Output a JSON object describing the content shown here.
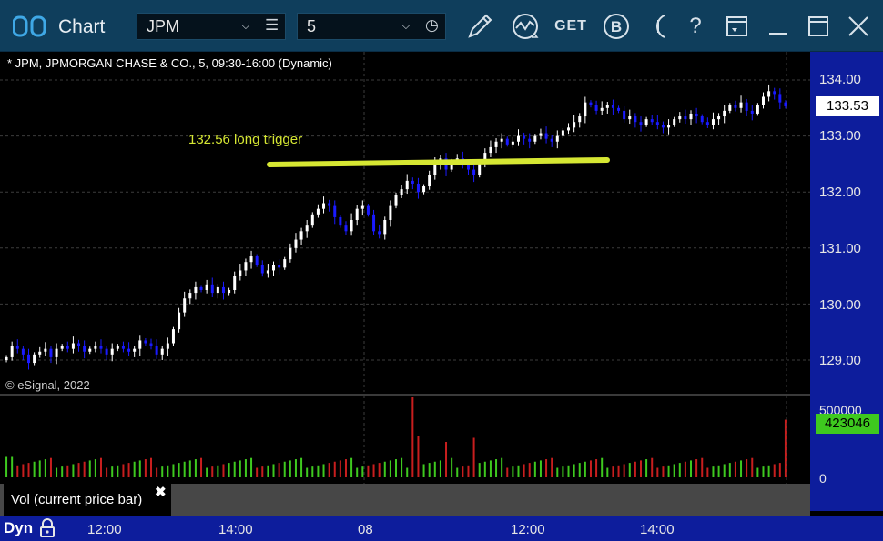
{
  "app": {
    "title": "Chart"
  },
  "toolbar": {
    "symbol": "JPM",
    "interval": "5",
    "get_label": "GET",
    "b_label": "B",
    "help_label": "?"
  },
  "chart": {
    "header": "* JPM, JPMORGAN CHASE & CO., 5, 09:30-16:00 (Dynamic)",
    "watermark": "© eSignal, 2022",
    "annotation": "132.56 long trigger",
    "last_price": "133.53",
    "last_volume": "423046",
    "price_labels": [
      "134.00",
      "133.00",
      "132.00",
      "131.00",
      "130.00",
      "129.00"
    ],
    "volume_labels": [
      "500000",
      "0"
    ],
    "time_labels": [
      "12:00",
      "14:00",
      "08",
      "12:00",
      "14:00"
    ],
    "volume_legend": "Vol (current price bar)",
    "mode_label": "Dyn",
    "colors": {
      "up": "#ffffff",
      "down": "#1a1aff",
      "vol_up": "#3ec91f",
      "vol_down": "#c81e1e",
      "trigger": "#d6e733",
      "axis_bg": "#0d1d9c"
    }
  },
  "chart_data": {
    "type": "candlestick",
    "title": "* JPM, JPMORGAN CHASE & CO., 5, 09:30-16:00 (Dynamic)",
    "ylim": [
      128.8,
      134.3
    ],
    "closes": [
      129.05,
      129.25,
      129.2,
      129.1,
      128.95,
      129.1,
      129.15,
      129.2,
      129.05,
      129.2,
      129.25,
      129.2,
      129.3,
      129.25,
      129.15,
      129.2,
      129.25,
      129.2,
      129.1,
      129.2,
      129.25,
      129.2,
      129.15,
      129.2,
      129.35,
      129.3,
      129.25,
      129.1,
      129.2,
      129.3,
      129.55,
      129.85,
      130.1,
      130.2,
      130.3,
      130.25,
      130.35,
      130.2,
      130.3,
      130.2,
      130.25,
      130.5,
      130.6,
      130.75,
      130.85,
      130.7,
      130.55,
      130.6,
      130.7,
      130.65,
      130.8,
      131.0,
      131.15,
      131.3,
      131.4,
      131.6,
      131.7,
      131.8,
      131.75,
      131.55,
      131.4,
      131.3,
      131.5,
      131.7,
      131.75,
      131.6,
      131.3,
      131.25,
      131.5,
      131.75,
      131.95,
      132.05,
      132.2,
      132.15,
      132.0,
      132.1,
      132.3,
      132.5,
      132.6,
      132.4,
      132.55,
      132.6,
      132.5,
      132.4,
      132.3,
      132.5,
      132.7,
      132.8,
      132.9,
      132.95,
      132.85,
      132.9,
      133.0,
      132.95,
      132.9,
      133.0,
      133.05,
      132.95,
      132.9,
      133.0,
      133.1,
      133.15,
      133.25,
      133.35,
      133.6,
      133.55,
      133.45,
      133.5,
      133.55,
      133.5,
      133.45,
      133.3,
      133.35,
      133.25,
      133.2,
      133.3,
      133.25,
      133.2,
      133.15,
      133.2,
      133.3,
      133.35,
      133.3,
      133.4,
      133.35,
      133.25,
      133.2,
      133.3,
      133.35,
      133.45,
      133.55,
      133.5,
      133.6,
      133.45,
      133.4,
      133.55,
      133.7,
      133.8,
      133.75,
      133.6,
      133.53
    ],
    "volume_range": [
      0,
      500000
    ],
    "last_volume": 423046,
    "annotation": {
      "text": "132.56 long trigger",
      "price": 132.56
    }
  }
}
